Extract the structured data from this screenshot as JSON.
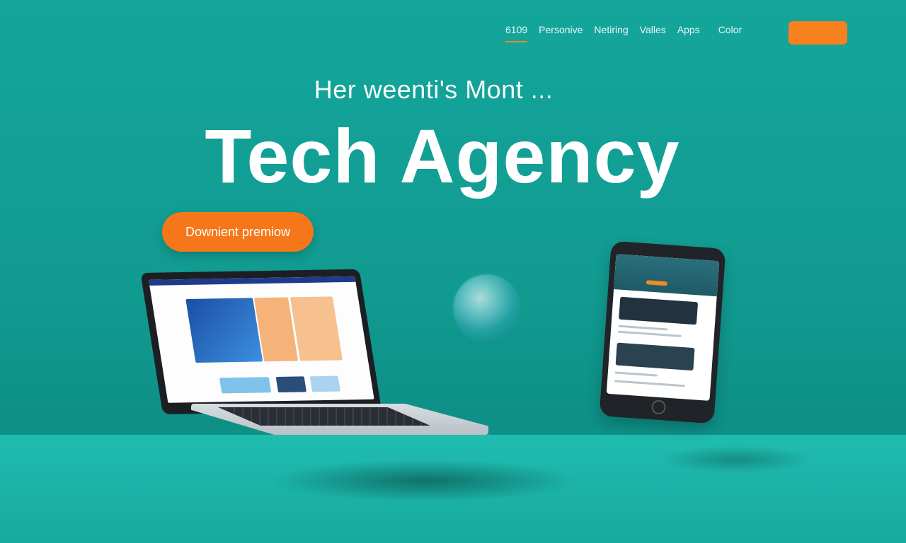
{
  "nav": {
    "items": [
      {
        "label": "6109",
        "active": true
      },
      {
        "label": "Personive",
        "active": false
      },
      {
        "label": "Netiring",
        "active": false
      },
      {
        "label": "Valles",
        "active": false
      },
      {
        "label": "Apps",
        "active": false
      },
      {
        "label": "Color",
        "active": false
      }
    ],
    "cta_label": ""
  },
  "hero": {
    "kicker": "Her weenti's Mont ...",
    "headline": "Tech Agency",
    "cta_label": "Downient premiow"
  },
  "colors": {
    "background": "#14a69b",
    "accent": "#f6771a",
    "headline": "#ffffff"
  },
  "devices": {
    "laptop": "laptop-mockup",
    "phone": "phone-mockup"
  }
}
